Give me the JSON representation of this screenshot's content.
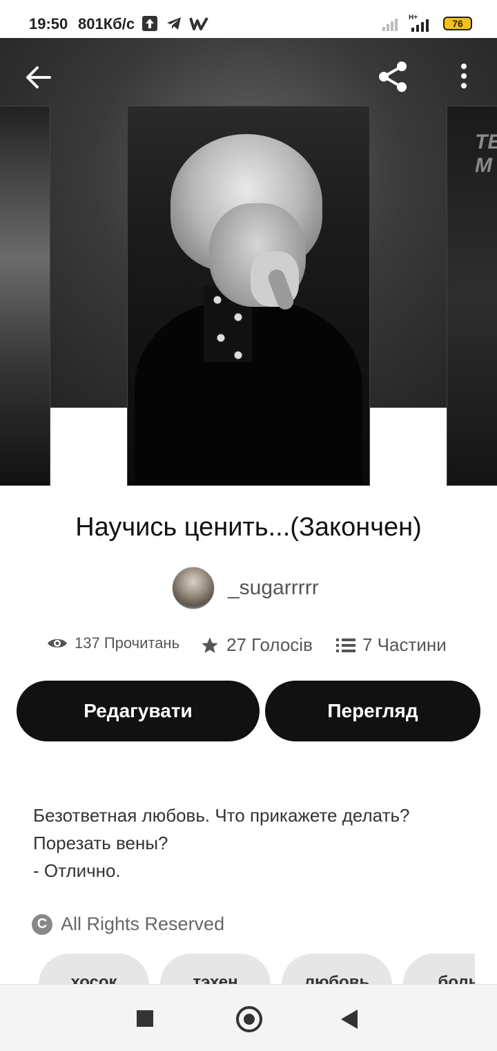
{
  "status_bar": {
    "time": "19:50",
    "speed": "801Кб/с",
    "network": "H+",
    "battery": "76",
    "icons": [
      "upload-icon",
      "telegram-icon",
      "w-icon",
      "signal-icon",
      "battery-icon"
    ]
  },
  "header": {
    "icons": [
      "back-arrow-icon",
      "share-icon",
      "more-vertical-icon"
    ],
    "right_cover_text": "TE\nM"
  },
  "story": {
    "title": "Научись ценить...(Закончен)",
    "author": "_sugarrrrr",
    "reads": "137 Прочитань",
    "votes": "27 Голосів",
    "parts": "7 Частини",
    "description": "Безответная любовь. Что прикажете делать?\nПорезать вены?\n- Отлично.",
    "rights": "All Rights Reserved"
  },
  "actions": {
    "edit_label": "Редагувати",
    "view_label": "Перегляд"
  },
  "tags": [
    "хосок",
    "тэхен",
    "любовь",
    "боль"
  ],
  "colors": {
    "button_bg": "#111111",
    "tag_bg": "#e6e6e6",
    "battery": "#f2c216"
  }
}
